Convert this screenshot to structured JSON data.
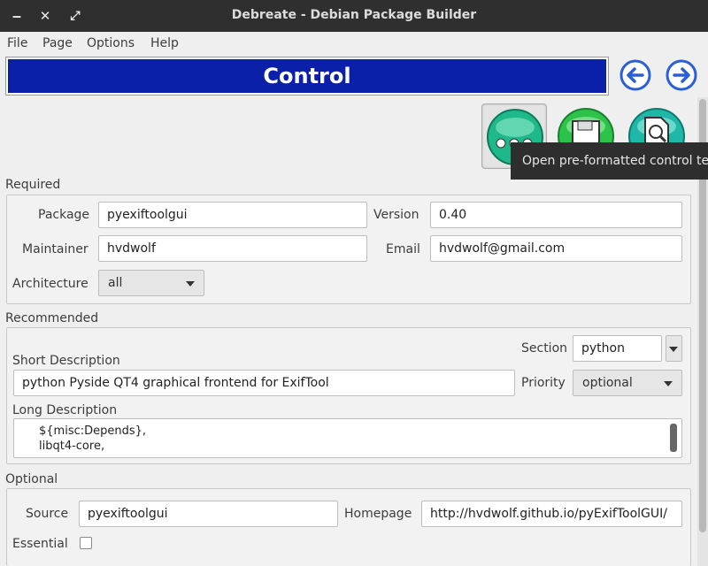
{
  "window": {
    "title": "Debreate - Debian Package Builder",
    "minimize": "‒",
    "close": "✕",
    "maximize": "⤢"
  },
  "menu": {
    "file": "File",
    "page": "Page",
    "options": "Options",
    "help": "Help"
  },
  "banner": {
    "title": "Control"
  },
  "tooltip": {
    "text": "Open pre-formatted control te"
  },
  "required": {
    "label": "Required",
    "package_label": "Package",
    "package_value": "pyexiftoolgui",
    "version_label": "Version",
    "version_value": "0.40",
    "maintainer_label": "Maintainer",
    "maintainer_value": "hvdwolf",
    "email_label": "Email",
    "email_value": "hvdwolf@gmail.com",
    "architecture_label": "Architecture",
    "architecture_value": "all"
  },
  "recommended": {
    "label": "Recommended",
    "section_label": "Section",
    "section_value": "python",
    "short_desc_label": "Short Description",
    "short_desc_value": "python Pyside QT4 graphical frontend for ExifTool",
    "priority_label": "Priority",
    "priority_value": "optional",
    "long_desc_label": "Long Description",
    "long_desc_line1": "${misc:Depends},",
    "long_desc_line2": "libqt4-core,"
  },
  "optional": {
    "label": "Optional",
    "source_label": "Source",
    "source_value": "pyexiftoolgui",
    "homepage_label": "Homepage",
    "homepage_value": "http://hvdwolf.github.io/pyExifToolGUI/",
    "essential_label": "Essential"
  },
  "colors": {
    "banner": "#0a20a8",
    "button_green": "#1fb88a",
    "nav_blue": "#2a5fd6",
    "titlebar": "#2f2f2f"
  }
}
